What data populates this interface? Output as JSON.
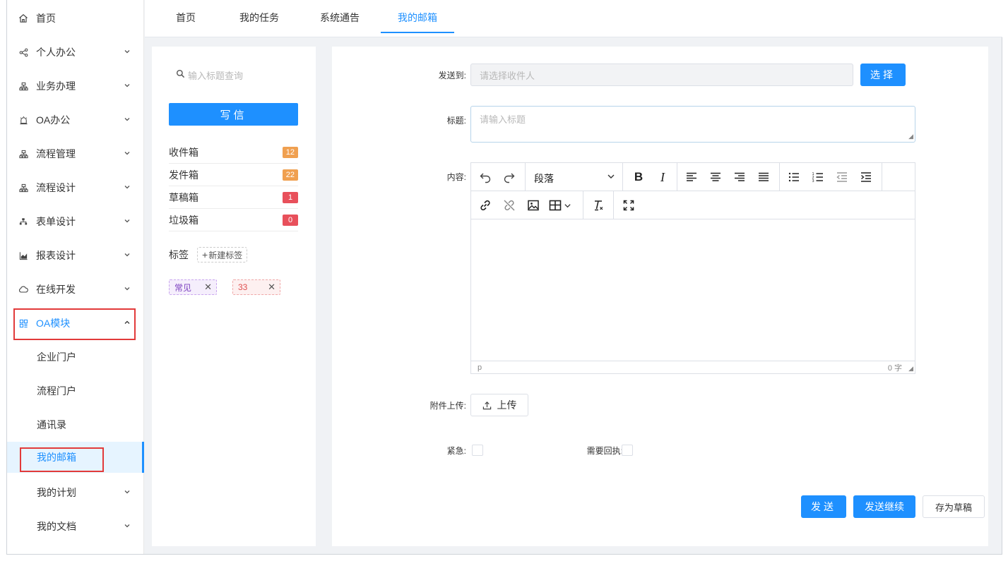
{
  "sidebar": {
    "items": [
      {
        "label": "首页",
        "icon": "home-icon",
        "arrow": ""
      },
      {
        "label": "个人办公",
        "icon": "share-icon",
        "arrow": "⌄"
      },
      {
        "label": "业务办理",
        "icon": "org-icon",
        "arrow": "⌄"
      },
      {
        "label": "OA办公",
        "icon": "alarm-icon",
        "arrow": "⌄"
      },
      {
        "label": "流程管理",
        "icon": "org-icon",
        "arrow": "⌄"
      },
      {
        "label": "流程设计",
        "icon": "org-icon",
        "arrow": "⌄"
      },
      {
        "label": "表单设计",
        "icon": "tree-icon",
        "arrow": "⌄"
      },
      {
        "label": "报表设计",
        "icon": "chart-icon",
        "arrow": "⌄"
      },
      {
        "label": "在线开发",
        "icon": "cloud-icon",
        "arrow": "⌄"
      },
      {
        "label": "OA模块",
        "icon": "grid-icon",
        "arrow": "⌃"
      }
    ],
    "sub_items": [
      {
        "label": "企业门户",
        "arrow": ""
      },
      {
        "label": "流程门户",
        "arrow": ""
      },
      {
        "label": "通讯录",
        "arrow": ""
      },
      {
        "label": "我的邮箱",
        "arrow": ""
      },
      {
        "label": "我的计划",
        "arrow": "⌄"
      },
      {
        "label": "我的文档",
        "arrow": "⌄"
      }
    ]
  },
  "tabs": [
    {
      "label": "首页"
    },
    {
      "label": "我的任务"
    },
    {
      "label": "系统通告"
    },
    {
      "label": "我的邮箱"
    }
  ],
  "mail": {
    "search_placeholder": "输入标题查询",
    "write_label": "写信",
    "folders": [
      {
        "label": "收件箱",
        "count": "12",
        "color": "#f0a050"
      },
      {
        "label": "发件箱",
        "count": "22",
        "color": "#f0a050"
      },
      {
        "label": "草稿箱",
        "count": "1",
        "color": "#e8505b"
      },
      {
        "label": "垃圾箱",
        "count": "0",
        "color": "#e8505b"
      }
    ],
    "tags_label": "标签",
    "new_tag_label": "新建标签",
    "tags": [
      {
        "label": "常见",
        "color": "#7b3fbf",
        "bg": "#f5eefc",
        "border": "#c9a6ef"
      },
      {
        "label": "33",
        "color": "#e05050",
        "bg": "#fdf0f0",
        "border": "#f0a8a8"
      }
    ]
  },
  "compose": {
    "to_label": "发送到:",
    "to_placeholder": "请选择收件人",
    "select_label": "选择",
    "title_label": "标题:",
    "title_placeholder": "请输入标题",
    "content_label": "内容:",
    "block_format": "段落",
    "status_path": "p",
    "word_count": "0 字",
    "attach_label": "附件上传:",
    "upload_label": "上传",
    "urgent_label": "紧急:",
    "receipt_label": "需要回执:",
    "send_label": "发送",
    "send_continue_label": "发送继续",
    "draft_label": "存为草稿"
  }
}
